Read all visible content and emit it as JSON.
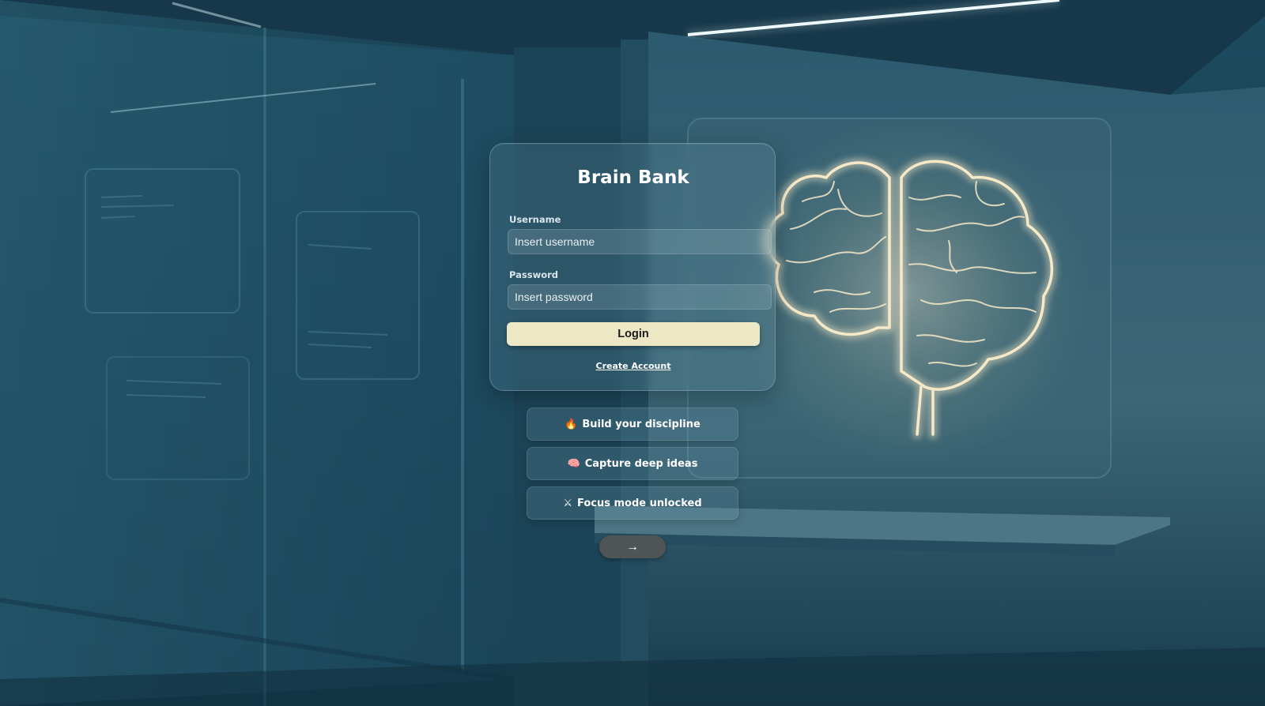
{
  "app": {
    "title": "Brain Bank"
  },
  "form": {
    "username_label": "Username",
    "username_placeholder": "Insert username",
    "password_label": "Password",
    "password_placeholder": "Insert password",
    "login_label": "Login",
    "create_account_label": "Create Account"
  },
  "features": [
    {
      "icon": "fire-icon",
      "glyph": "🔥",
      "label": "Build your discipline"
    },
    {
      "icon": "brain-icon",
      "glyph": "🧠",
      "label": "Capture deep ideas"
    },
    {
      "icon": "crossed-swords-icon",
      "glyph": "⚔",
      "label": "Focus mode unlocked"
    }
  ],
  "next_button": {
    "icon": "right-arrow-icon",
    "glyph": "→"
  },
  "colors": {
    "background": "#1a4256",
    "login_button": "#ece8c6",
    "brain_glow": "#f6e9c8",
    "arrow_button": "#4f5557"
  }
}
